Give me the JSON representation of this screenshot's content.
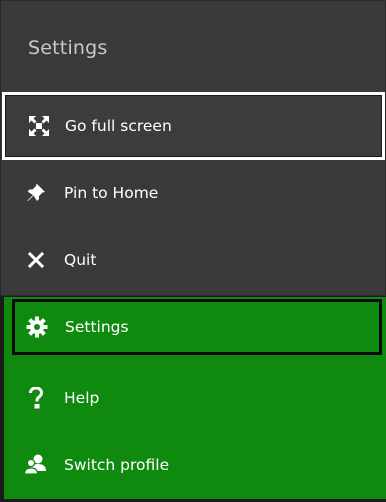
{
  "menu": {
    "title": "Settings",
    "items": [
      {
        "label": "Go full screen",
        "icon": "fullscreen-arrows-icon"
      },
      {
        "label": "Pin to Home",
        "icon": "pin-icon"
      },
      {
        "label": "Quit",
        "icon": "close-x-icon"
      }
    ]
  },
  "guide_menu": {
    "items": [
      {
        "label": "Settings",
        "icon": "gear-icon"
      },
      {
        "label": "Help",
        "icon": "question-mark-icon"
      },
      {
        "label": "Switch profile",
        "icon": "switch-profile-icon"
      }
    ]
  },
  "colors": {
    "menu_background": "#3b3a3b",
    "accent_green": "#0f8a0f",
    "focus_border": "#ffffff"
  }
}
